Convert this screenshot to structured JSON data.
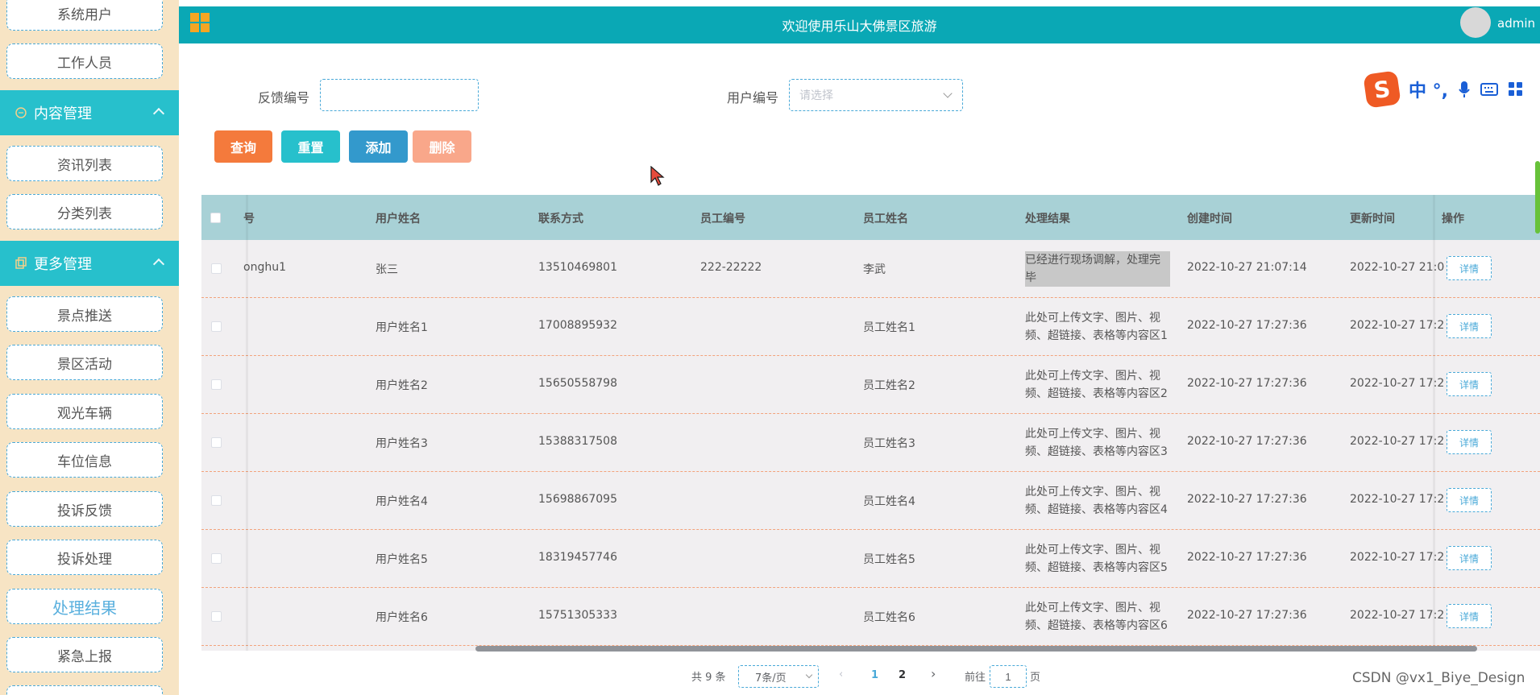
{
  "sidebar": {
    "items_top": [
      "系统用户",
      "工作人员"
    ],
    "group_content": "内容管理",
    "items_content": [
      "资讯列表",
      "分类列表"
    ],
    "group_more": "更多管理",
    "items_more": [
      "景点推送",
      "景区活动",
      "观光车辆",
      "车位信息",
      "投诉反馈",
      "投诉处理",
      "处理结果",
      "紧急上报"
    ]
  },
  "header": {
    "title": "欢迎使用乐山大佛景区旅游",
    "user": "admin"
  },
  "search": {
    "feedback_label": "反馈编号",
    "feedback_value": "",
    "user_label": "用户编号",
    "user_placeholder": "请选择"
  },
  "buttons": {
    "query": "查询",
    "reset": "重置",
    "add": "添加",
    "delete": "删除"
  },
  "ime": {
    "chars": "中 °,",
    "logo": "S"
  },
  "table": {
    "headers": [
      "号",
      "用户姓名",
      "联系方式",
      "员工编号",
      "员工姓名",
      "处理结果",
      "创建时间",
      "更新时间",
      "操作"
    ],
    "detail_label": "详情",
    "rows": [
      {
        "id": "onghu1",
        "name": "张三",
        "phone": "13510469801",
        "emp_no": "222-22222",
        "emp_name": "李武",
        "result": "已经进行现场调解，处理完毕",
        "created": "2022-10-27 21:07:14",
        "updated": "2022-10-27 21:0"
      },
      {
        "id": "",
        "name": "用户姓名1",
        "phone": "17008895932",
        "emp_no": "",
        "emp_name": "员工姓名1",
        "result": "此处可上传文字、图片、视频、超链接、表格等内容区1",
        "created": "2022-10-27 17:27:36",
        "updated": "2022-10-27 17:2"
      },
      {
        "id": "",
        "name": "用户姓名2",
        "phone": "15650558798",
        "emp_no": "",
        "emp_name": "员工姓名2",
        "result": "此处可上传文字、图片、视频、超链接、表格等内容区2",
        "created": "2022-10-27 17:27:36",
        "updated": "2022-10-27 17:2"
      },
      {
        "id": "",
        "name": "用户姓名3",
        "phone": "15388317508",
        "emp_no": "",
        "emp_name": "员工姓名3",
        "result": "此处可上传文字、图片、视频、超链接、表格等内容区3",
        "created": "2022-10-27 17:27:36",
        "updated": "2022-10-27 17:2"
      },
      {
        "id": "",
        "name": "用户姓名4",
        "phone": "15698867095",
        "emp_no": "",
        "emp_name": "员工姓名4",
        "result": "此处可上传文字、图片、视频、超链接、表格等内容区4",
        "created": "2022-10-27 17:27:36",
        "updated": "2022-10-27 17:2"
      },
      {
        "id": "",
        "name": "用户姓名5",
        "phone": "18319457746",
        "emp_no": "",
        "emp_name": "员工姓名5",
        "result": "此处可上传文字、图片、视频、超链接、表格等内容区5",
        "created": "2022-10-27 17:27:36",
        "updated": "2022-10-27 17:2"
      },
      {
        "id": "",
        "name": "用户姓名6",
        "phone": "15751305333",
        "emp_no": "",
        "emp_name": "员工姓名6",
        "result": "此处可上传文字、图片、视频、超链接、表格等内容区6",
        "created": "2022-10-27 17:27:36",
        "updated": "2022-10-27 17:2"
      }
    ]
  },
  "pagination": {
    "total": "共 9 条",
    "page_size": "7条/页",
    "pages": [
      "1",
      "2"
    ],
    "goto_label": "前往",
    "goto_value": "1",
    "page_suffix": "页"
  },
  "watermark": "CSDN @vx1_Biye_Design",
  "colors": {
    "accent": "#0aa8b5",
    "sidebar_bg": "#f7e4c4",
    "query_btn": "#f47a3c",
    "reset_btn": "#27c0cc",
    "add_btn": "#3399cc",
    "delete_btn": "#f9a78a"
  }
}
